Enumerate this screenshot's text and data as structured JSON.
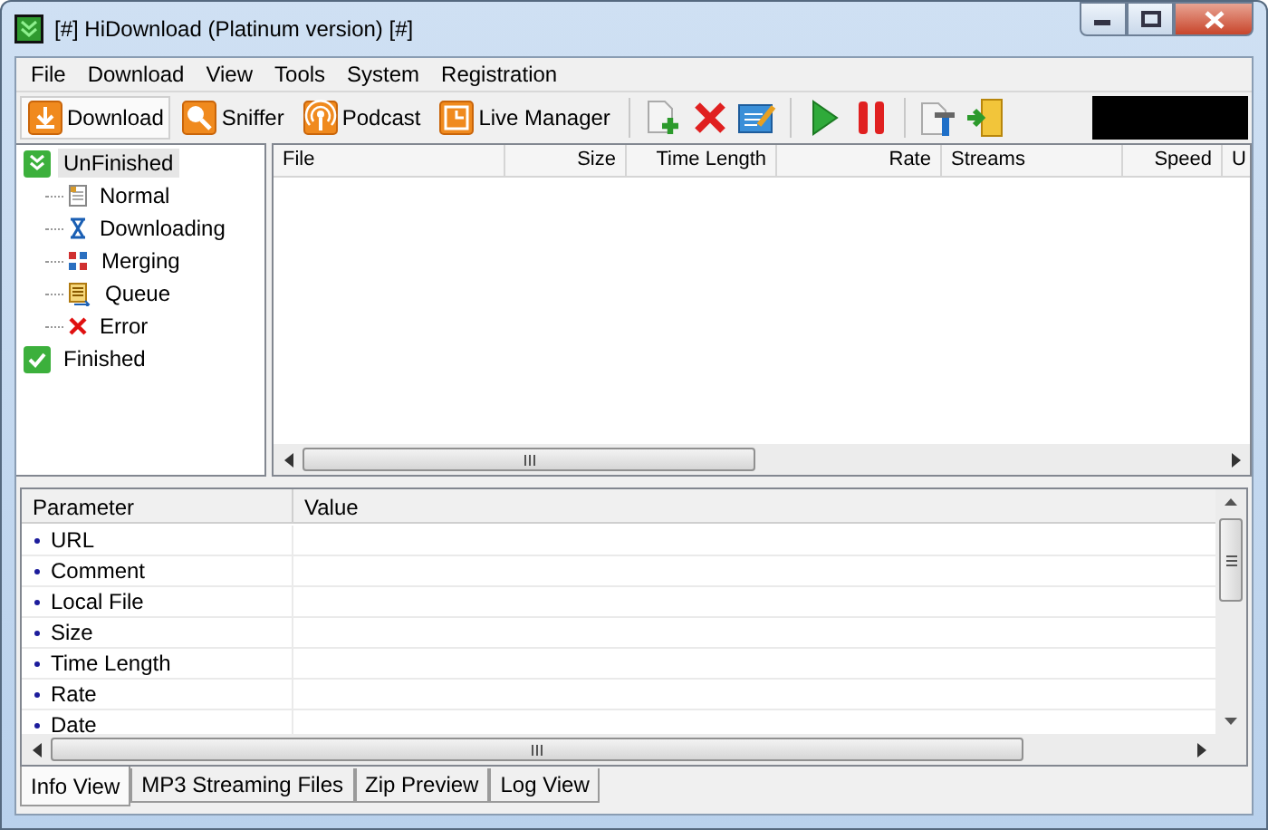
{
  "window": {
    "title": "[#] HiDownload (Platinum version) [#]"
  },
  "menu": [
    "File",
    "Download",
    "View",
    "Tools",
    "System",
    "Registration"
  ],
  "toolbar": {
    "buttons": [
      {
        "label": "Download",
        "selected": true
      },
      {
        "label": "Sniffer",
        "selected": false
      },
      {
        "label": "Podcast",
        "selected": false
      },
      {
        "label": "Live Manager",
        "selected": false
      }
    ]
  },
  "tree": [
    {
      "label": "UnFinished",
      "selected": true,
      "children": [
        {
          "label": "Normal"
        },
        {
          "label": "Downloading"
        },
        {
          "label": "Merging"
        },
        {
          "label": "Queue"
        },
        {
          "label": "Error"
        }
      ]
    },
    {
      "label": "Finished",
      "selected": false
    }
  ],
  "table": {
    "columns": [
      "File",
      "Size",
      "Time Length",
      "Rate",
      "Streams",
      "Speed",
      "U"
    ]
  },
  "info": {
    "columns": [
      "Parameter",
      "Value"
    ],
    "rows": [
      "URL",
      "Comment",
      "Local File",
      "Size",
      "Time Length",
      "Rate",
      "Date"
    ]
  },
  "bottom_tabs": [
    {
      "label": "Info View",
      "selected": true
    },
    {
      "label": "MP3 Streaming Files",
      "selected": false
    },
    {
      "label": "Zip Preview",
      "selected": false
    },
    {
      "label": "Log View",
      "selected": false
    }
  ]
}
